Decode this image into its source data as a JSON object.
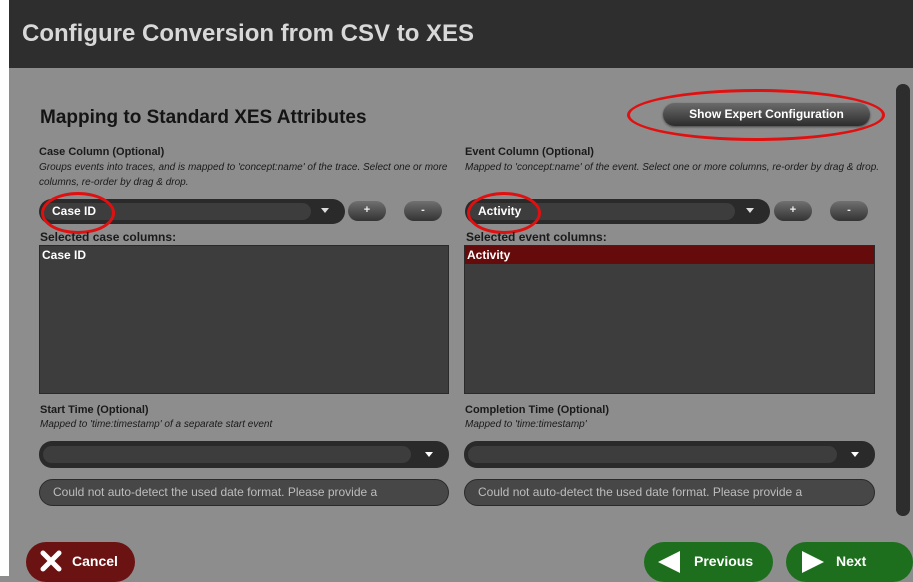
{
  "window": {
    "title": "Configure Conversion from CSV to XES"
  },
  "section": {
    "title": "Mapping to Standard XES Attributes",
    "expert_button": "Show Expert Configuration"
  },
  "case_column": {
    "title": "Case Column (Optional)",
    "description": "Groups events into traces, and is mapped to 'concept:name' of the trace. Select one or more columns, re-order by drag & drop.",
    "selected_value": "Case ID",
    "add_label": "+",
    "remove_label": "-",
    "list_label": "Selected case columns:",
    "items": [
      "Case ID"
    ]
  },
  "event_column": {
    "title": "Event Column (Optional)",
    "description": "Mapped to 'concept:name' of the event. Select one or more columns, re-order by drag & drop.",
    "selected_value": "Activity",
    "add_label": "+",
    "remove_label": "-",
    "list_label": "Selected event columns:",
    "items": [
      "Activity"
    ]
  },
  "start_time": {
    "title": "Start Time (Optional)",
    "description": "Mapped to 'time:timestamp' of a separate start event",
    "selected_value": "",
    "date_format_placeholder": "Could not auto-detect the used date format. Please provide a"
  },
  "completion_time": {
    "title": "Completion Time (Optional)",
    "description": "Mapped to 'time:timestamp'",
    "selected_value": "",
    "date_format_placeholder": "Could not auto-detect the used date format. Please provide a"
  },
  "footer": {
    "cancel_label": "Cancel",
    "previous_label": "Previous",
    "next_label": "Next"
  },
  "colors": {
    "accent_red": "#e01010",
    "cancel": "#6b1212",
    "nav_green": "#1d6f1d",
    "selected_row": "#660b0b"
  }
}
